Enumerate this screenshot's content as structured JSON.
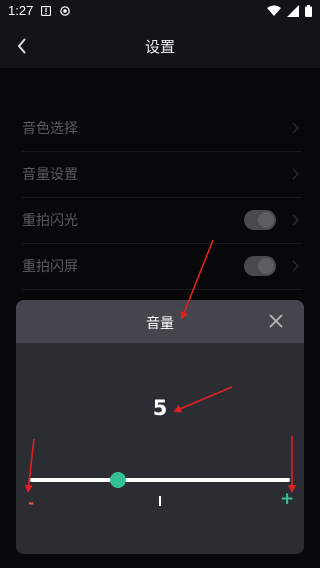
{
  "status_bar": {
    "time": "1:27",
    "left_icons": [
      "alert-icon",
      "record-icon"
    ],
    "right_icons": [
      "wifi-icon",
      "signal-icon",
      "battery-icon"
    ]
  },
  "header": {
    "title": "设置",
    "back_icon": "chevron-left-icon"
  },
  "settings": {
    "items": [
      {
        "label": "音色选择",
        "has_toggle": false
      },
      {
        "label": "音量设置",
        "has_toggle": false
      },
      {
        "label": "重拍闪光",
        "has_toggle": true,
        "toggle_on": false
      },
      {
        "label": "重拍闪屏",
        "has_toggle": true,
        "toggle_on": false
      }
    ]
  },
  "dialog": {
    "title": "音量",
    "close_icon": "close-icon",
    "value": "5",
    "slider": {
      "position_fraction": 0.34,
      "minus_label": "-",
      "plus_label": "+"
    }
  },
  "colors": {
    "background": "#08080a",
    "dialog_bg": "#2c2c33",
    "dialog_header_bg": "#45454d",
    "accent_green": "#36c194",
    "minus_red": "#e5534b",
    "annotation_red": "#e02020"
  }
}
